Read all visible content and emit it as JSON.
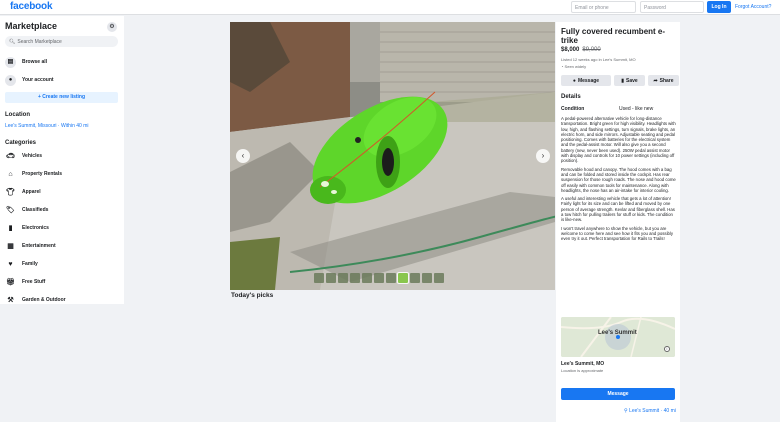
{
  "header": {
    "logo": "facebook",
    "email_placeholder": "Email or phone",
    "password_placeholder": "Password",
    "login_label": "Log In",
    "forgot_label": "Forgot Account?"
  },
  "sidebar": {
    "title": "Marketplace",
    "search_placeholder": "Search Marketplace",
    "nav": [
      {
        "label": "Browse all",
        "icon": "store-icon"
      },
      {
        "label": "Your account",
        "icon": "user-icon"
      }
    ],
    "create_label": "+ Create new listing",
    "location_heading": "Location",
    "location_value": "Lee's Summit, Missouri · Within 40 mi",
    "categories_heading": "Categories",
    "categories": [
      {
        "label": "Vehicles",
        "icon": "car-icon"
      },
      {
        "label": "Property Rentals",
        "icon": "house-icon"
      },
      {
        "label": "Apparel",
        "icon": "shirt-icon"
      },
      {
        "label": "Classifieds",
        "icon": "tag-icon"
      },
      {
        "label": "Electronics",
        "icon": "phone-icon"
      },
      {
        "label": "Entertainment",
        "icon": "film-icon"
      },
      {
        "label": "Family",
        "icon": "heart-icon"
      },
      {
        "label": "Free Stuff",
        "icon": "gift-icon"
      },
      {
        "label": "Garden & Outdoor",
        "icon": "shovel-icon"
      }
    ]
  },
  "gallery": {
    "thumb_count": 11,
    "active_thumb": 7,
    "todays_picks": "Today's picks"
  },
  "listing": {
    "title": "Fully covered recumbent e-trike",
    "price": "$8,000",
    "old_price": "$9,000",
    "listed": "Listed 12 weeks ago in Lee's Summit, MO",
    "seen": "Seen widely",
    "actions": {
      "message": "Message",
      "save": "Save",
      "share": "Share"
    },
    "details_heading": "Details",
    "condition_label": "Condition",
    "condition_value": "Used - like new",
    "description": [
      "A pedal-powered alternative vehicle for long-distance transportation. Bright green for high visibility. Headlights with low, high, and flashing settings, turn signals, brake lights, an electric horn, and side mirrors. Adjustable seating and pedal positioning. Comes with batteries for the electrical system and the pedal-assist motor. Will also give you a second battery (new, never been used). 250W pedal assist motor with display and controls for 10 power settings (including off position).",
      "Removable hood and canopy. The hood comes with a bag and can be folded and stored inside the cockpit. Has rear suspension for those rough roads. The nose and hood come off easily with common tools for maintenance. Along with headlights, the nose has an air-intake for interior cooling.",
      "A useful and interesting vehicle that gets a lot of attention! Fairly light for its size and can be lifted and moved by one person of average strength. Kevlar and fiberglass shell. Has a tow hitch for pulling trailers for stuff or kids. The condition is like-new.",
      "I won't travel anywhere to show the vehicle, but you are welcome to come here and see how it fits you and possibly even try it out. Perfect transportation for Rails to Trails!"
    ],
    "map_label": "Lee's Summit",
    "city": "Lee's Summit, MO",
    "approx": "Location is approximate",
    "message_button": "Message",
    "bottom_location": "Lee's Summit · 40 mi"
  },
  "colors": {
    "brand": "#1877f2",
    "vehicle_green": "#5ed62a"
  }
}
